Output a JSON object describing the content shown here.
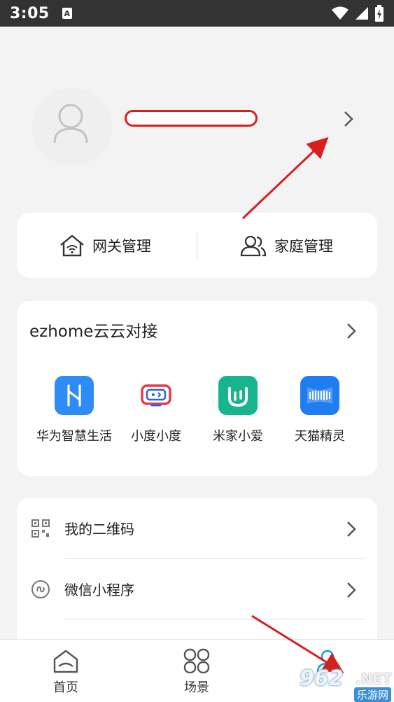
{
  "status_bar": {
    "time": "3:05",
    "a_badge": "A"
  },
  "profile": {
    "username_redacted": ""
  },
  "gateway_card": {
    "gateway_label": "网关管理",
    "family_label": "家庭管理"
  },
  "ezhome_card": {
    "title": "ezhome云云对接",
    "apps": [
      {
        "label": "华为智慧生活",
        "icon": "huawei-hilink-icon",
        "color": "#2f8cf6"
      },
      {
        "label": "小度小度",
        "icon": "xiaodu-icon",
        "color": "#e83a4a"
      },
      {
        "label": "米家小爱",
        "icon": "mijia-icon",
        "color": "#17b48e"
      },
      {
        "label": "天猫精灵",
        "icon": "tmall-genie-icon",
        "color": "#1f7df2"
      }
    ]
  },
  "list_card": {
    "items": [
      {
        "label": "我的二维码",
        "icon": "qr-code-icon"
      },
      {
        "label": "微信小程序",
        "icon": "mini-program-icon"
      }
    ]
  },
  "bottom_nav": {
    "items": [
      {
        "label": "首页",
        "icon": "home-icon"
      },
      {
        "label": "场景",
        "icon": "scene-icon"
      },
      {
        "label": "",
        "icon": "user-icon"
      }
    ]
  },
  "watermark": {
    "number": "962",
    "net": ".NET",
    "cn": "乐游网"
  }
}
